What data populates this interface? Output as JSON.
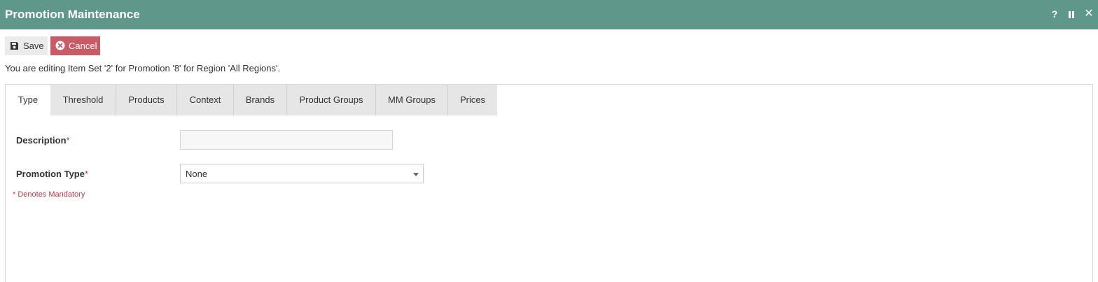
{
  "window": {
    "title": "Promotion Maintenance",
    "help_glyph": "?",
    "close_glyph": "✕"
  },
  "toolbar": {
    "save_label": "Save",
    "cancel_label": "Cancel"
  },
  "info_text": "You are editing Item Set '2' for Promotion '8' for Region 'All Regions'.",
  "tabs": [
    {
      "label": "Type",
      "active": true
    },
    {
      "label": "Threshold",
      "active": false
    },
    {
      "label": "Products",
      "active": false
    },
    {
      "label": "Context",
      "active": false
    },
    {
      "label": "Brands",
      "active": false
    },
    {
      "label": "Product Groups",
      "active": false
    },
    {
      "label": "MM Groups",
      "active": false
    },
    {
      "label": "Prices",
      "active": false
    }
  ],
  "form": {
    "description": {
      "label": "Description",
      "required_mark": "*",
      "value": ""
    },
    "promotion_type": {
      "label": "Promotion Type",
      "required_mark": "*",
      "value": "None"
    },
    "mandatory_note": "* Denotes Mandatory"
  },
  "colors": {
    "titlebar": "#5f978a",
    "cancel": "#c95b67",
    "required": "#c0394b"
  },
  "icons": [
    "floppy-disk-icon",
    "circle-x-icon",
    "help-icon",
    "pause-icon",
    "close-icon",
    "dropdown-caret-icon"
  ]
}
